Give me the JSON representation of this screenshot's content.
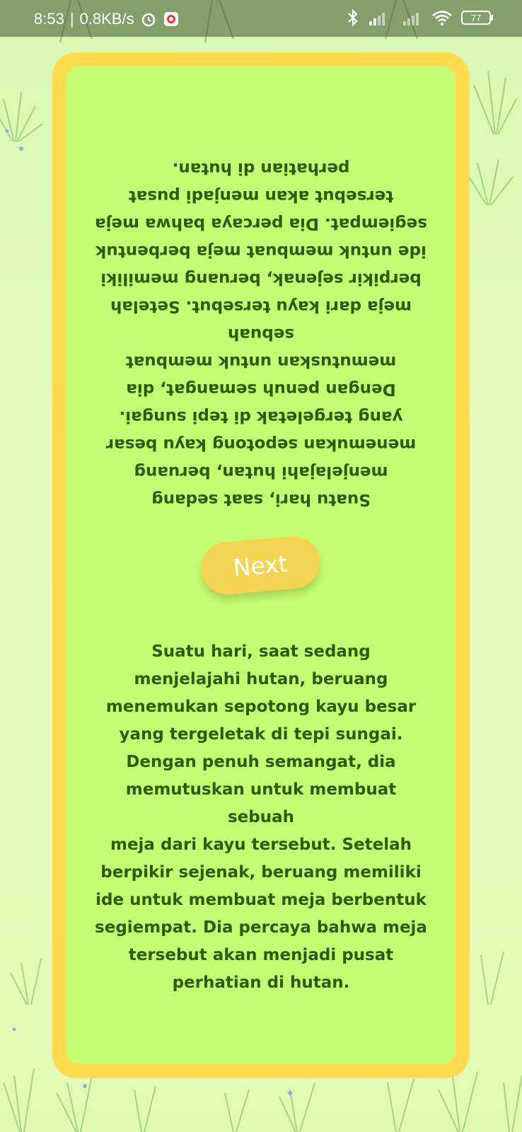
{
  "status_bar": {
    "time": "8:53",
    "separator": "|",
    "net_speed": "0.8KB/s",
    "battery": "77",
    "icons": [
      "alarm-icon",
      "record-icon",
      "bluetooth-icon",
      "signal-icon",
      "wifi-icon",
      "battery-icon"
    ]
  },
  "story": {
    "mirrored_text": "Suatu hari, saat sedang\nmenjelajahi hutan, beruang\nmenemukan sepotong kayu besar\nyang tergeletak di tepi sungai.\nDengan penuh semangat, dia\nmemutuskan untuk membuat sebuah\nmeja dari kayu tersebut. Setelah\nberpikir sejenak, beruang memiliki\nide untuk membuat meja berbentuk\nsegiempat. Dia percaya bahwa meja\ntersebut akan menjadi pusat\nperhatian di hutan.",
    "text": "Suatu hari, saat sedang\nmenjelajahi hutan, beruang\nmenemukan sepotong kayu besar\nyang tergeletak di tepi sungai.\nDengan penuh semangat, dia\nmemutuskan untuk membuat sebuah\nmeja dari kayu tersebut. Setelah\nberpikir sejenak, beruang memiliki\nide untuk membuat meja berbentuk\nsegiempat. Dia percaya bahwa meja\ntersebut akan menjadi pusat\nperhatian di hutan."
  },
  "next_button": {
    "label": "Next"
  },
  "colors": {
    "card_border": "#ffdb4d",
    "card_fill": "#c5fd73",
    "text": "#2e5b0e",
    "button": "#f3d453"
  }
}
